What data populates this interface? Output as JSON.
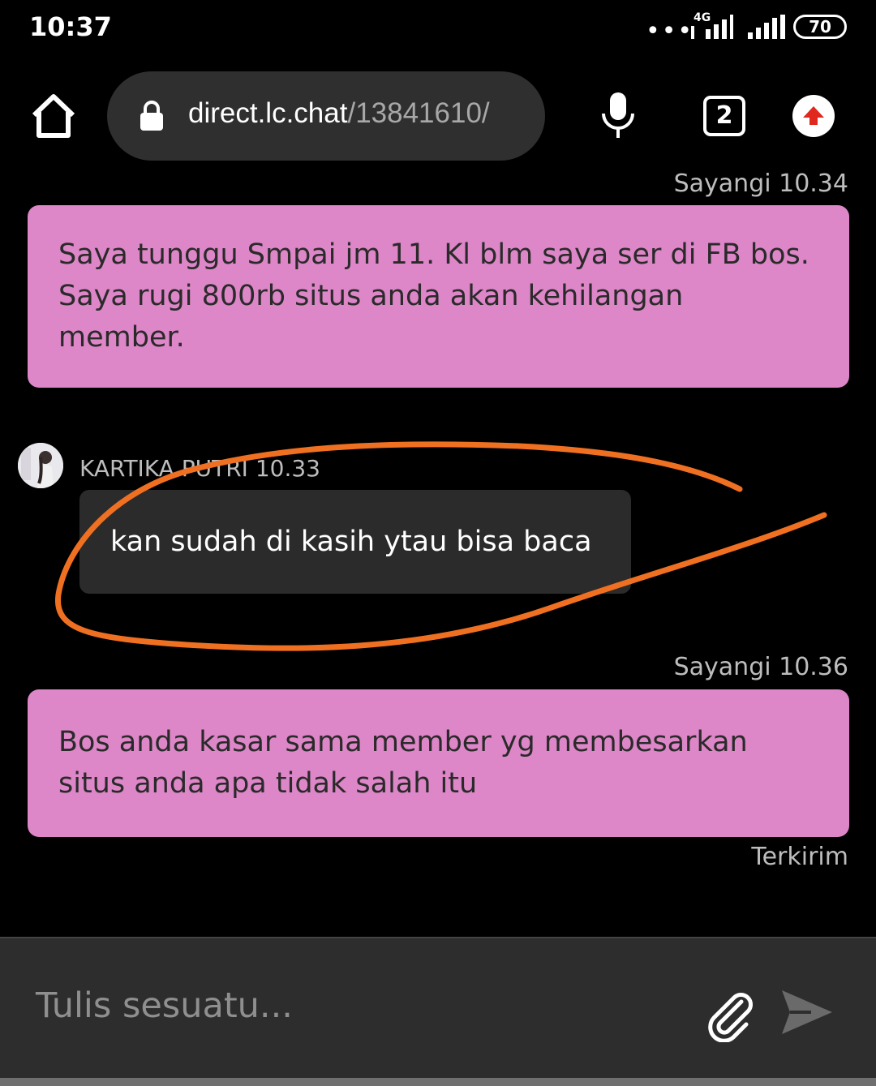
{
  "status_bar": {
    "time": "10:37",
    "dots": "•••",
    "network": "4G",
    "battery": "70"
  },
  "browser": {
    "url_domain": "direct.lc.chat",
    "url_path": "/13841610/",
    "tab_count": "2",
    "icons": [
      "home-icon",
      "lock-icon",
      "microphone-icon",
      "tabs-icon",
      "update-arrow-icon"
    ]
  },
  "chat": {
    "messages": [
      {
        "meta": "Sayangi 10.34",
        "text": "Saya tunggu Smpai jm 11. Kl blm saya ser di FB bos. Saya rugi 800rb situs anda akan kehilangan member."
      },
      {
        "sender": "KARTIKA PUTRI 10.33",
        "text": "kan sudah di kasih ytau bisa baca"
      },
      {
        "meta": "Sayangi 10.36",
        "text": "Bos anda kasar sama member yg membesarkan situs anda apa tidak salah itu"
      }
    ],
    "delivery_status": "Terkirim",
    "annotation_color": "#f07022",
    "outgoing_color": "#dd86c8",
    "incoming_color": "#2b2b2b"
  },
  "composer": {
    "placeholder": "Tulis sesuatu...",
    "icons": [
      "paperclip-icon",
      "send-icon"
    ]
  }
}
